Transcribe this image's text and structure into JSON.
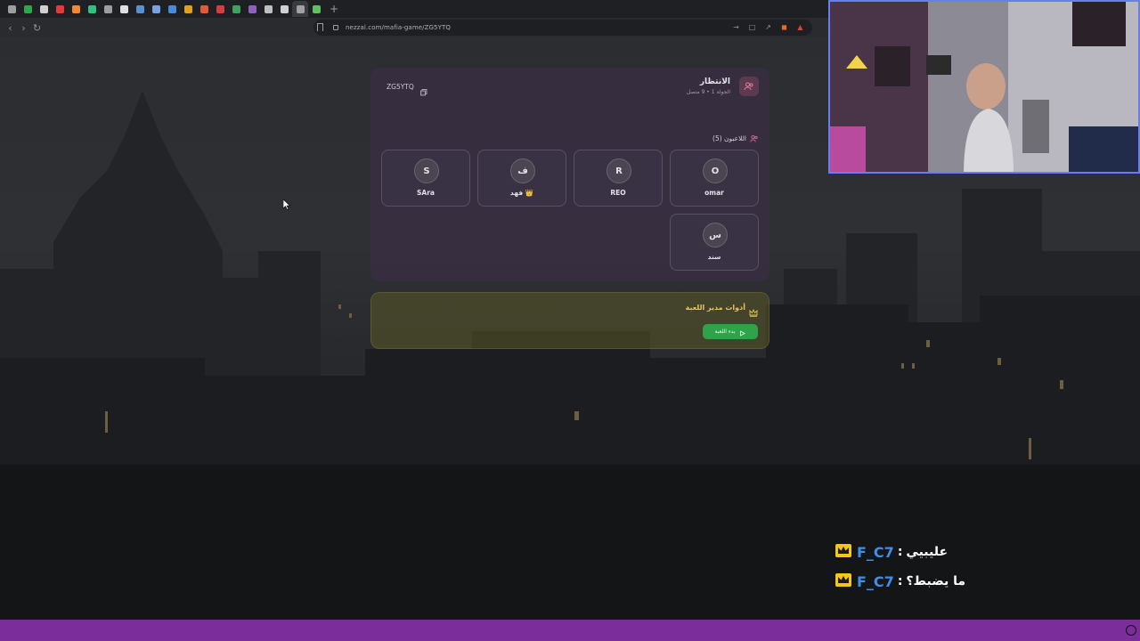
{
  "browser": {
    "url": "nezzal.com/mafia-game/ZG5YTQ",
    "tabs": [
      "#9e9e9e",
      "#2aa84a",
      "#d0d0d0",
      "#e03c3c",
      "#f08a30",
      "#2ec27e",
      "#9e9e9e",
      "#e0e0e0",
      "#5a8fd0",
      "#7aa0e0",
      "#4a8ad8",
      "#e0a020",
      "#e05a3a",
      "#d04040",
      "#40a060",
      "#9060c0",
      "#c0c0c0",
      "#d0d0d0",
      "#a0a0a0",
      "#60c060"
    ],
    "icons": [
      "translate-icon",
      "open-icon",
      "share-icon",
      "brave-icon",
      "warning-icon"
    ]
  },
  "game": {
    "status_title": "الانتظار",
    "status_sub": "الجولة 1 • 9 متصل",
    "room_code": "ZG5YTQ",
    "players_label": "اللاعبون (5)",
    "players": [
      {
        "initial": "O",
        "name": "omar"
      },
      {
        "initial": "R",
        "name": "REO"
      },
      {
        "initial": "ف",
        "name": "فهد 👑"
      },
      {
        "initial": "S",
        "name": "SAra"
      },
      {
        "initial": "س",
        "name": "سند"
      }
    ],
    "admin_title": "أدوات مدير اللعبة",
    "start_label": "بدء اللعبة"
  },
  "chat": [
    {
      "user": "F_C7",
      "message": "عليبيي"
    },
    {
      "user": "F_C7",
      "message": "ما يضبط؟"
    }
  ],
  "colors": {
    "accent_purple": "#7b2d9c",
    "start_green": "#2ea34a",
    "admin_gold": "#e9c74a",
    "chat_user_blue": "#3f8ee8",
    "crown_gold": "#f5c518"
  }
}
